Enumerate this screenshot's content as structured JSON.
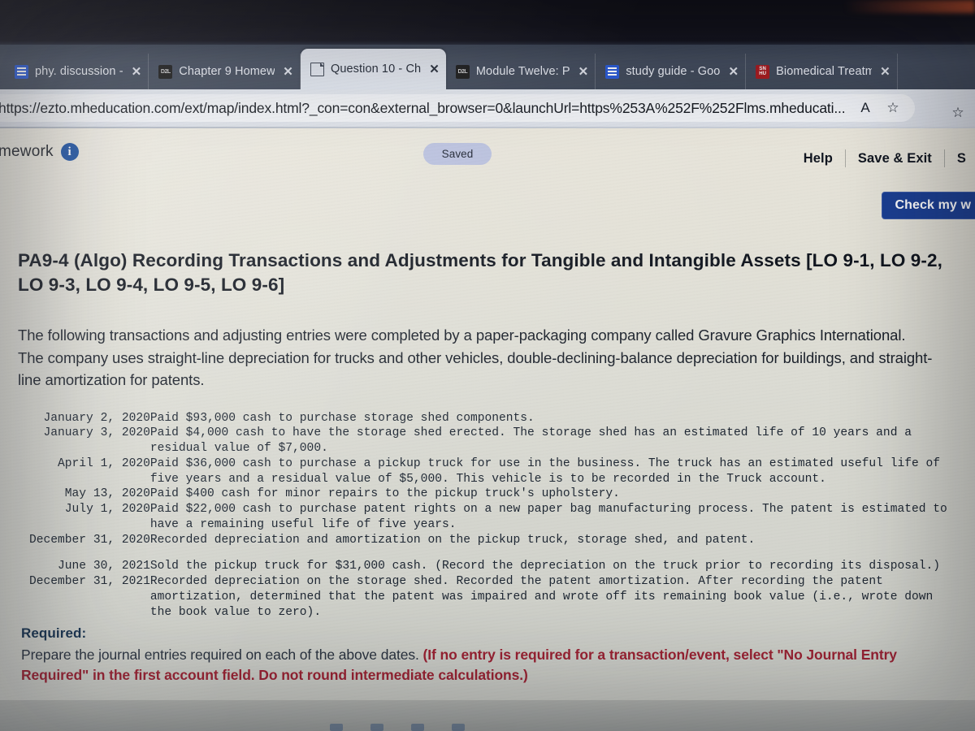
{
  "browser": {
    "tabs": [
      {
        "label": "phy. discussion -",
        "icon": "google-docs-icon",
        "active": false,
        "favtype": "docs"
      },
      {
        "label": "Chapter 9 Homew",
        "icon": "d2l-icon",
        "active": false,
        "favtype": "d2l"
      },
      {
        "label": "Question 10 - Ch",
        "icon": "page-icon",
        "active": true,
        "favtype": "page"
      },
      {
        "label": "Module Twelve: P",
        "icon": "d2l-icon",
        "active": false,
        "favtype": "d2l"
      },
      {
        "label": "study guide - Goo",
        "icon": "google-docs-icon",
        "active": false,
        "favtype": "docs"
      },
      {
        "label": "Biomedical Treatm",
        "icon": "snhu-icon",
        "active": false,
        "favtype": "red"
      }
    ],
    "close_glyph": "✕",
    "url": "https://ezto.mheducation.com/ext/map/index.html?_con=con&external_browser=0&launchUrl=https%253A%252F%252Flms.mheducati...",
    "read_aloud_glyph": "A",
    "favorite_glyph": "☆",
    "collections_glyph": "☆"
  },
  "app": {
    "header": {
      "homework_label": "mework",
      "info_glyph": "i",
      "saved_label": "Saved",
      "help_label": "Help",
      "save_exit_label": "Save & Exit",
      "submit_label": "S",
      "check_my_work_label": "Check my w"
    },
    "problem": {
      "title": "PA9-4 (Algo) Recording Transactions and Adjustments for Tangible and Intangible Assets [LO 9-1, LO 9-2, LO 9-3, LO 9-4, LO 9-5, LO 9-6]",
      "intro": "The following transactions and adjusting entries were completed by a paper-packaging company called Gravure Graphics International. The company uses straight-line depreciation for trucks and other vehicles, double-declining-balance depreciation for buildings, and straight-line amortization for patents.",
      "transactions_2020": [
        {
          "date": "January 2, 2020",
          "description": "Paid $93,000 cash to purchase storage shed components."
        },
        {
          "date": "January 3, 2020",
          "description": "Paid $4,000 cash to have the storage shed erected. The storage shed has an estimated life of 10 years and a\nresidual value of $7,000."
        },
        {
          "date": "April 1, 2020",
          "description": "Paid $36,000 cash to purchase a pickup truck for use in the business. The truck has an estimated useful life of\nfive years and a residual value of $5,000. This vehicle is to be recorded in the Truck account."
        },
        {
          "date": "May 13, 2020",
          "description": "Paid $400 cash for minor repairs to the pickup truck's upholstery."
        },
        {
          "date": "July 1, 2020",
          "description": "Paid $22,000 cash to purchase patent rights on a new paper bag manufacturing process. The patent is estimated to\nhave a remaining useful life of five years."
        },
        {
          "date": "December 31, 2020",
          "description": "Recorded depreciation and amortization on the pickup truck, storage shed, and patent."
        }
      ],
      "transactions_2021": [
        {
          "date": "June 30, 2021",
          "description": "Sold the pickup truck for $31,000 cash. (Record the depreciation on the truck prior to recording its disposal.)"
        },
        {
          "date": "December 31, 2021",
          "description": "Recorded depreciation on the storage shed. Recorded the patent amortization. After recording the patent\namortization, determined that the patent was impaired and wrote off its remaining book value (i.e., wrote down\nthe book value to zero)."
        }
      ],
      "required_label": "Required:",
      "required_text_plain": "Prepare the journal entries required on each of the above dates. ",
      "required_text_red": "(If no entry is required for a transaction/event, select \"No Journal Entry Required\" in the first account field. Do not round intermediate calculations.)"
    }
  },
  "colors": {
    "accent_blue": "#1b3f93",
    "saved_pill": "#b9c0dd",
    "required_red": "#9b2233",
    "tab_strip": "#3f4858",
    "page_bg": "#dcdcd4"
  }
}
